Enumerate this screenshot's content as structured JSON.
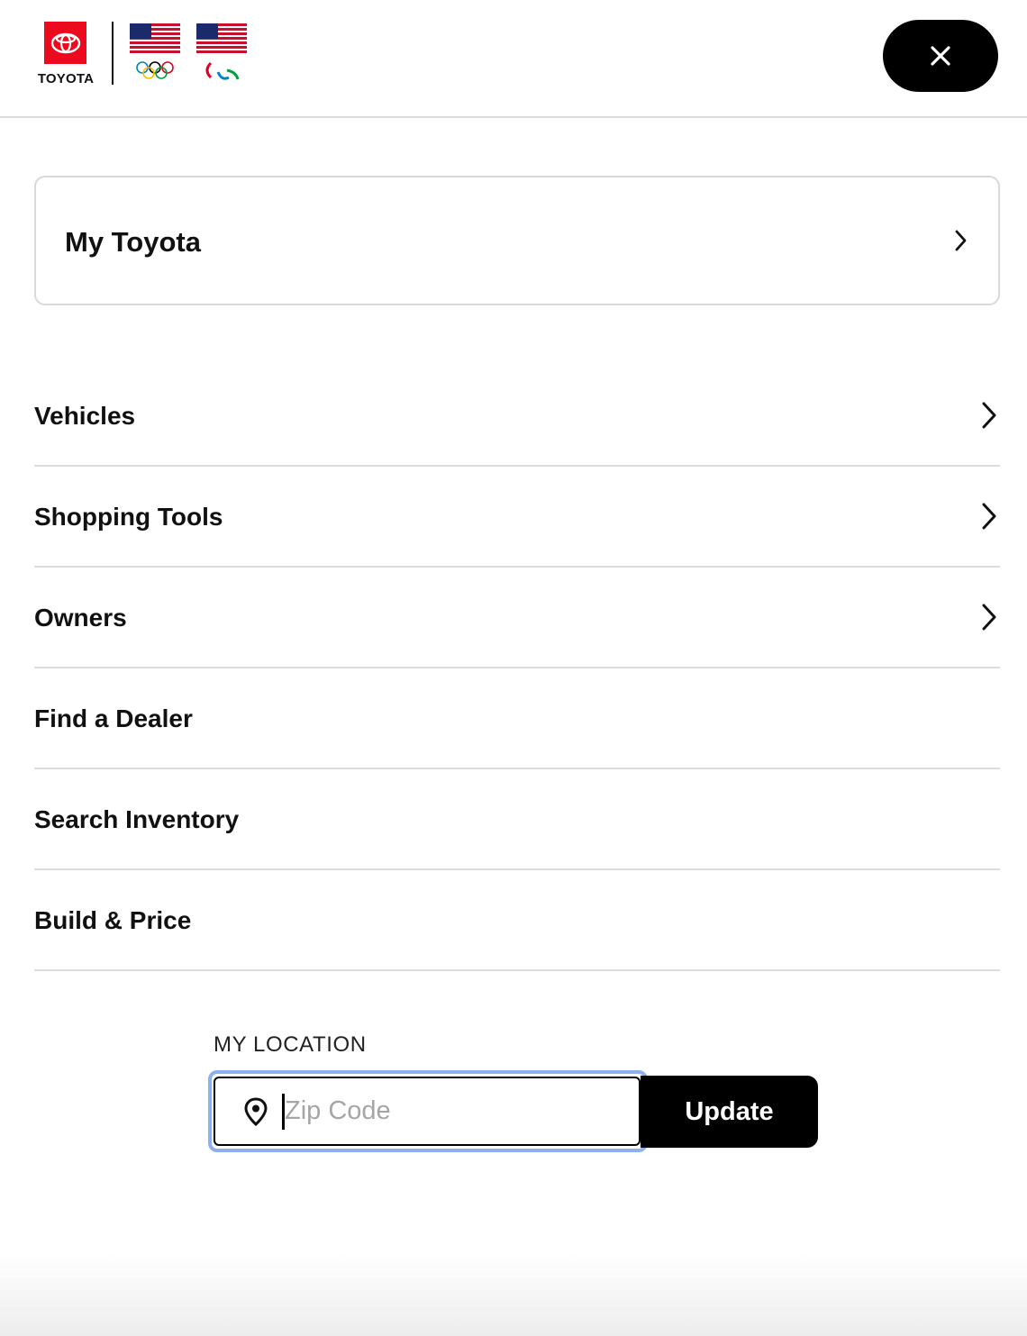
{
  "header": {
    "brand_name": "TOYOTA",
    "close_icon": "close-icon",
    "brand_color": "#eb0a1e"
  },
  "my_toyota": {
    "label": "My Toyota",
    "icon": "chevron-right-icon"
  },
  "menu": {
    "items": [
      {
        "label": "Vehicles",
        "has_chevron": true
      },
      {
        "label": "Shopping Tools",
        "has_chevron": true
      },
      {
        "label": "Owners",
        "has_chevron": true
      },
      {
        "label": "Find a Dealer",
        "has_chevron": false
      },
      {
        "label": "Search Inventory",
        "has_chevron": false
      },
      {
        "label": "Build & Price",
        "has_chevron": false
      }
    ]
  },
  "location": {
    "title": "MY LOCATION",
    "zip_placeholder": "Zip Code",
    "zip_value": "",
    "update_label": "Update",
    "pin_icon": "location-pin-icon",
    "focus_color": "#8fb0f0"
  }
}
